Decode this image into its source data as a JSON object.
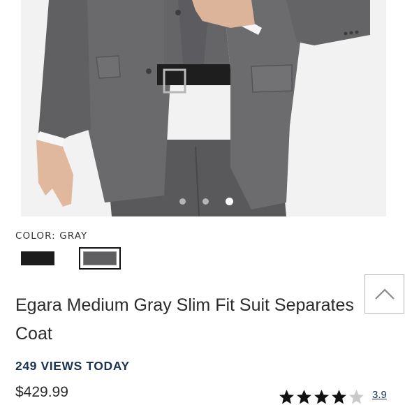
{
  "product": {
    "images": {
      "count": 3,
      "active_index": 2
    },
    "color": {
      "label": "COLOR: GRAY",
      "swatches": [
        {
          "name": "Black",
          "hex": "#1c1c1c",
          "selected": false
        },
        {
          "name": "Gray",
          "hex": "#5f5f62",
          "selected": true
        }
      ]
    },
    "title": "Egara Medium Gray Slim Fit Suit Separates Coat",
    "views_text": "249 VIEWS TODAY",
    "price": "$429.99",
    "rating": {
      "value": "3.9",
      "stars_filled": 4,
      "stars_total": 5
    }
  },
  "colors": {
    "accent_navy": "#1a3353",
    "suit_gray": "#5f5f62"
  },
  "icons": {
    "back_to_top": "chevron-up-icon",
    "star": "star-icon"
  }
}
